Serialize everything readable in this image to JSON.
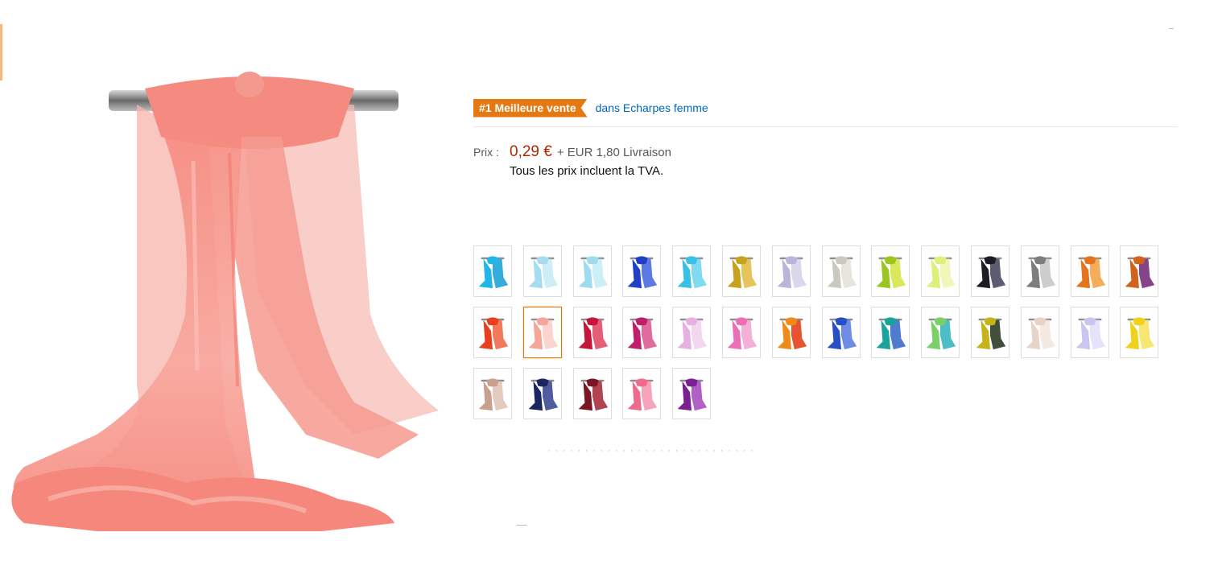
{
  "bestseller": {
    "badge": "#1 Meilleure vente",
    "category_link": "dans Echarpes femme",
    "badge_color": "#e47911"
  },
  "price": {
    "label": "Prix :",
    "value": "0,29 €",
    "shipping": "+ EUR 1,80 Livraison",
    "vat_note": "Tous les prix incluent la TVA.",
    "price_color": "#b12704"
  },
  "product_image": {
    "main_color": "#f58a7f",
    "rod_color": "#8a8a8a"
  },
  "swatches": {
    "selected_index": 15,
    "colors": [
      [
        "#20b6e8",
        "#1fa3d6"
      ],
      [
        "#a6dcef",
        "#c9ecf6"
      ],
      [
        "#9fdbee",
        "#c6ecf5"
      ],
      [
        "#1f3fc7",
        "#4b6be0"
      ],
      [
        "#39c0e6",
        "#73d6f0"
      ],
      [
        "#c8a11f",
        "#e2bf49"
      ],
      [
        "#b9b4d8",
        "#d6d2ea"
      ],
      [
        "#c9c9bd",
        "#e2e2d8"
      ],
      [
        "#9bc51f",
        "#d6e64a"
      ],
      [
        "#dff07a",
        "#eef6b1"
      ],
      [
        "#1c1c24",
        "#4a4a60"
      ],
      [
        "#7d7d7d",
        "#c8c8c8"
      ],
      [
        "#e5741f",
        "#f2a44a"
      ],
      [
        "#d0621b",
        "#7a2f7c"
      ],
      [
        "#e8401f",
        "#f16c4a"
      ],
      [
        "#f5a59a",
        "#f9cfc8"
      ],
      [
        "#c4163a",
        "#e04d67"
      ],
      [
        "#c01e6a",
        "#de5b95"
      ],
      [
        "#e8b0e1",
        "#f2d2ee"
      ],
      [
        "#ec6fb5",
        "#f3a6d2"
      ],
      [
        "#f08b1a",
        "#e2431d"
      ],
      [
        "#2850c6",
        "#5e7fe0"
      ],
      [
        "#1aa39a",
        "#3c6ec9"
      ],
      [
        "#7cd06a",
        "#3ab7c0"
      ],
      [
        "#c5b31a",
        "#2c3b26"
      ],
      [
        "#e8d3c8",
        "#f3e6de"
      ],
      [
        "#c9c6f0",
        "#e2e0f8"
      ],
      [
        "#f0d21b",
        "#f6e463"
      ],
      [
        "#c8a08d",
        "#e0c6b8"
      ],
      [
        "#1b2560",
        "#3c4a92"
      ],
      [
        "#7a1624",
        "#a8303e"
      ],
      [
        "#ef6a8c",
        "#f59ab2"
      ],
      [
        "#7b1f92",
        "#a84fc0"
      ]
    ]
  },
  "more_link": "· · · · · · · · · · · · · · · · · · · · · · · · · · · ·"
}
